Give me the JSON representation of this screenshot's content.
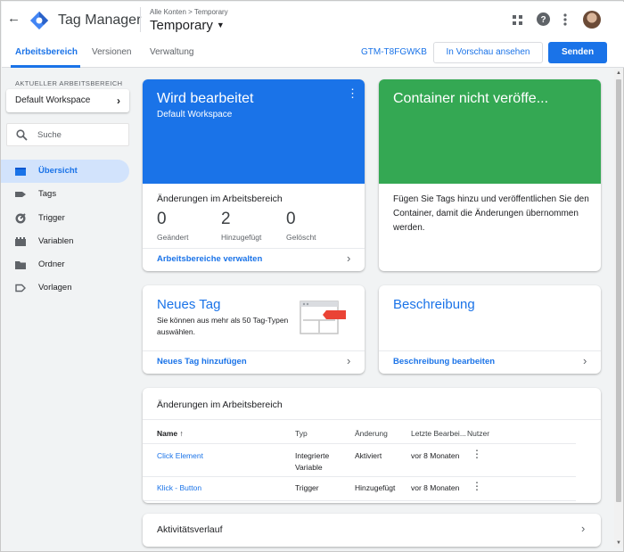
{
  "header": {
    "app_title": "Tag Manager",
    "breadcrumb": "Alle Konten > Temporary",
    "container_name": "Temporary",
    "icons": [
      "back-arrow-icon",
      "gtm-logo-icon",
      "apps-grid-icon",
      "help-icon",
      "more-vert-icon"
    ]
  },
  "tabs": [
    {
      "label": "Arbeitsbereich",
      "active": true
    },
    {
      "label": "Versionen"
    },
    {
      "label": "Verwaltung"
    }
  ],
  "toolbar": {
    "container_id": "GTM-T8FGWKB",
    "preview_label": "In Vorschau ansehen",
    "submit_label": "Senden"
  },
  "sidebar": {
    "workspace_label": "AKTUELLER ARBEITSBEREICH",
    "workspace_name": "Default Workspace",
    "search_placeholder": "Suche",
    "items": [
      {
        "label": "Übersicht",
        "icon": "overview-icon",
        "active": true
      },
      {
        "label": "Tags",
        "icon": "tag-icon"
      },
      {
        "label": "Trigger",
        "icon": "trigger-icon"
      },
      {
        "label": "Variablen",
        "icon": "variables-icon"
      },
      {
        "label": "Ordner",
        "icon": "folder-icon"
      },
      {
        "label": "Vorlagen",
        "icon": "template-icon"
      }
    ]
  },
  "editing_card": {
    "title": "Wird bearbeitet",
    "subtitle": "Default Workspace",
    "section_title": "Änderungen im Arbeitsbereich",
    "stats": [
      {
        "value": "0",
        "label": "Geändert"
      },
      {
        "value": "2",
        "label": "Hinzugefügt"
      },
      {
        "value": "0",
        "label": "Gelöscht"
      }
    ],
    "link": "Arbeitsbereiche verwalten",
    "color": "#1a73e8"
  },
  "container_card": {
    "title": "Container nicht veröffe...",
    "body": "Fügen Sie Tags hinzu und veröffentlichen Sie den Container, damit die Änderungen übernommen werden.",
    "color": "#34a853"
  },
  "new_tag_card": {
    "title": "Neues Tag",
    "description": "Sie können aus mehr als 50 Tag-Typen auswählen.",
    "link": "Neues Tag hinzufügen"
  },
  "description_card": {
    "title": "Beschreibung",
    "link": "Beschreibung bearbeiten"
  },
  "changes_table": {
    "title": "Änderungen im Arbeitsbereich",
    "columns": [
      "Name",
      "Typ",
      "Änderung",
      "Letzte Bearbei...",
      "Nutzer"
    ],
    "sort_icon": "arrow-up-icon",
    "rows": [
      {
        "name": "Click Element",
        "type": "Integrierte Variable",
        "change": "Aktiviert",
        "last_edited": "vor 8 Monaten"
      },
      {
        "name": "Klick - Button",
        "type": "Trigger",
        "change": "Hinzugefügt",
        "last_edited": "vor 8 Monaten"
      }
    ]
  },
  "activity_card": {
    "title": "Aktivitätsverlauf"
  }
}
